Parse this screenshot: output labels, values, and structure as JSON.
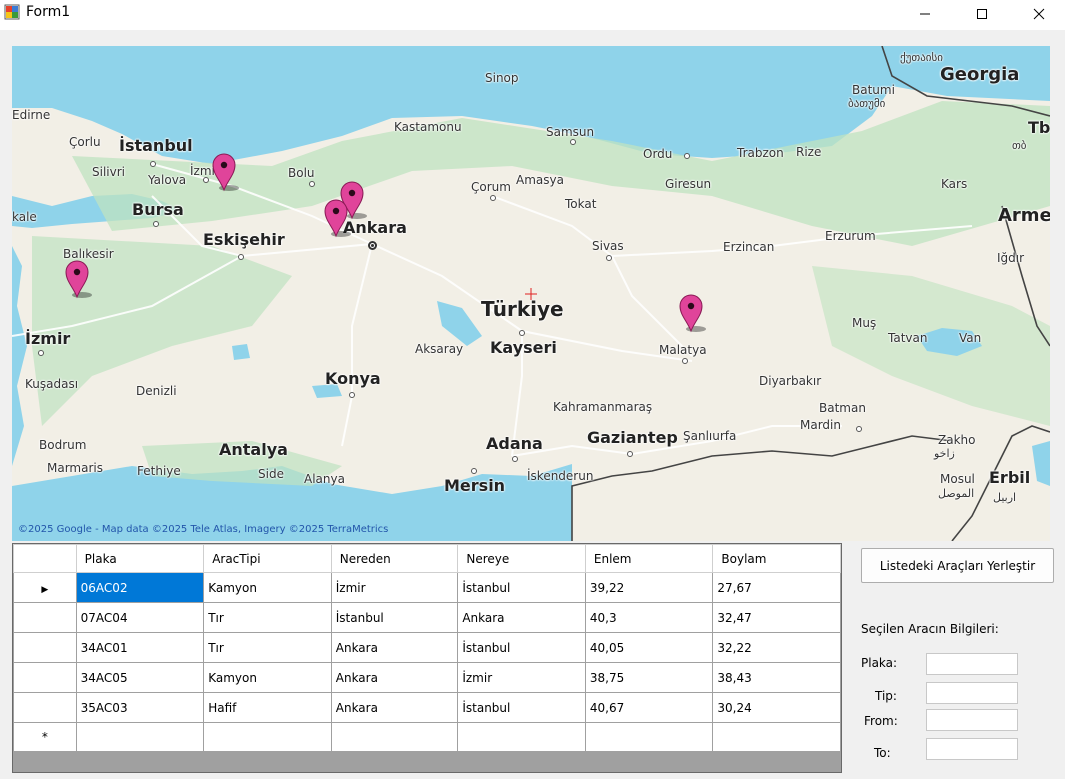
{
  "window": {
    "title": "Form1"
  },
  "map": {
    "copyright": "©2025 Google - Map data ©2025 Tele Atlas, Imagery ©2025 TerraMetrics",
    "labels": {
      "edirne": "Edirne",
      "sinop": "Sinop",
      "georgia_local": "ქუთაისი",
      "georgia": "Georgia",
      "batumi": "Batumi",
      "batumi_local": "ბათუმი",
      "tb": "Tb",
      "tb_local": "თბ",
      "corlu": "Çorlu",
      "istanbul": "İstanbul",
      "kastamonu": "Kastamonu",
      "samsun": "Samsun",
      "silivri": "Silivri",
      "yalova": "Yalova",
      "izmit": "İzmi",
      "bolu": "Bolu",
      "ordu": "Ordu",
      "trabzon": "Trabzon",
      "rize": "Rize",
      "corum": "Çorum",
      "amasya": "Amasya",
      "giresun": "Giresun",
      "kars": "Kars",
      "kale": "kale",
      "bursa": "Bursa",
      "tokat": "Tokat",
      "armenia": "Arme",
      "ankara": "Ankara",
      "eskisehir": "Eskişehir",
      "sivas": "Sivas",
      "erzincan": "Erzincan",
      "erzurum": "Erzurum",
      "balikesir": "Balıkesir",
      "igdir": "Iğdır",
      "turkiye": "Türkiye",
      "mus": "Muş",
      "tatvan": "Tatvan",
      "van": "Van",
      "izmir": "İzmir",
      "aksaray": "Aksaray",
      "kayseri": "Kayseri",
      "malatya": "Malatya",
      "kusadasi": "Kuşadası",
      "konya": "Konya",
      "diyarbakir": "Diyarbakır",
      "denizli": "Denizli",
      "batman": "Batman",
      "kahramanmaras": "Kahramanmaraş",
      "mardin": "Mardin",
      "bodrum": "Bodrum",
      "antalya": "Antalya",
      "adana": "Adana",
      "gaziantep": "Gaziantep",
      "sanliurfa": "Şanlıurfa",
      "zakho": "Zakho",
      "zakho_local": "زاخو",
      "marmaris": "Marmaris",
      "fethiye": "Fethiye",
      "side": "Side",
      "alanya": "Alanya",
      "iskenderun": "İskenderun",
      "mersin": "Mersin",
      "mosul": "Mosul",
      "mosul_local": "الموصل",
      "erbil": "Erbil",
      "erbil_local": "اربيل"
    },
    "colors": {
      "sea": "#8fd3ea",
      "land": "#f2efe6",
      "green": "#bfe3c0",
      "marker": "#e0449a",
      "road": "#ffffff",
      "border": "#444444"
    }
  },
  "grid": {
    "columns": [
      "Plaka",
      "AracTipi",
      "Nereden",
      "Nereye",
      "Enlem",
      "Boylam"
    ],
    "rows": [
      [
        "06AC02",
        "Kamyon",
        "İzmir",
        "İstanbul",
        "39,22",
        "27,67"
      ],
      [
        "07AC04",
        "Tır",
        "İstanbul",
        "Ankara",
        "40,3",
        "32,47"
      ],
      [
        "34AC01",
        "Tır",
        "Ankara",
        "İstanbul",
        "40,05",
        "32,22"
      ],
      [
        "34AC05",
        "Kamyon",
        "Ankara",
        "İzmir",
        "38,75",
        "38,43"
      ],
      [
        "35AC03",
        "Hafif",
        "Ankara",
        "İstanbul",
        "40,67",
        "30,24"
      ]
    ],
    "current_row_glyph": "▶",
    "new_row_glyph": "*"
  },
  "panel": {
    "place_button": "Listedeki Araçları Yerleştir",
    "info_title": "Seçilen Aracın Bilgileri:",
    "plaka_label": "Plaka:",
    "tip_label": "Tip:",
    "from_label": "From:",
    "to_label": "To:",
    "plaka_value": "",
    "tip_value": "",
    "from_value": "",
    "to_value": ""
  }
}
